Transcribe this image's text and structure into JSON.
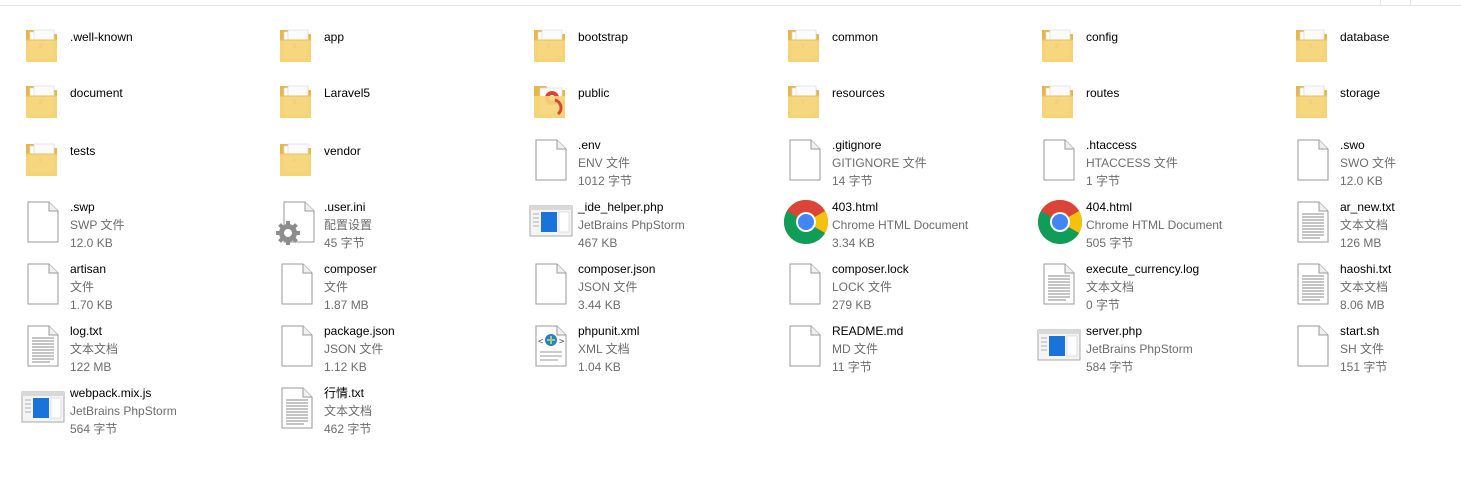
{
  "window": {
    "title": ""
  },
  "items": [
    {
      "name": ".well-known",
      "type": "",
      "size": "",
      "icon": "folder-icon"
    },
    {
      "name": "app",
      "type": "",
      "size": "",
      "icon": "folder-icon"
    },
    {
      "name": "bootstrap",
      "type": "",
      "size": "",
      "icon": "folder-icon"
    },
    {
      "name": "common",
      "type": "",
      "size": "",
      "icon": "folder-icon"
    },
    {
      "name": "config",
      "type": "",
      "size": "",
      "icon": "folder-icon"
    },
    {
      "name": "database",
      "type": "",
      "size": "",
      "icon": "folder-icon"
    },
    {
      "name": "document",
      "type": "",
      "size": "",
      "icon": "folder-icon"
    },
    {
      "name": "Laravel5",
      "type": "",
      "size": "",
      "icon": "folder-icon"
    },
    {
      "name": "public",
      "type": "",
      "size": "",
      "icon": "folder-chrome-icon"
    },
    {
      "name": "resources",
      "type": "",
      "size": "",
      "icon": "folder-icon"
    },
    {
      "name": "routes",
      "type": "",
      "size": "",
      "icon": "folder-icon"
    },
    {
      "name": "storage",
      "type": "",
      "size": "",
      "icon": "folder-icon"
    },
    {
      "name": "tests",
      "type": "",
      "size": "",
      "icon": "folder-icon"
    },
    {
      "name": "vendor",
      "type": "",
      "size": "",
      "icon": "folder-icon"
    },
    {
      "name": ".env",
      "type": "ENV 文件",
      "size": "1012 字节",
      "icon": "file-icon"
    },
    {
      "name": ".gitignore",
      "type": "GITIGNORE 文件",
      "size": "14 字节",
      "icon": "file-icon"
    },
    {
      "name": ".htaccess",
      "type": "HTACCESS 文件",
      "size": "1 字节",
      "icon": "file-icon"
    },
    {
      "name": ".swo",
      "type": "SWO 文件",
      "size": "12.0 KB",
      "icon": "file-icon"
    },
    {
      "name": ".swp",
      "type": "SWP 文件",
      "size": "12.0 KB",
      "icon": "file-icon"
    },
    {
      "name": ".user.ini",
      "type": "配置设置",
      "size": "45 字节",
      "icon": "settings-file-icon"
    },
    {
      "name": "_ide_helper.php",
      "type": "JetBrains PhpStorm",
      "size": "467 KB",
      "icon": "phpstorm-file-icon"
    },
    {
      "name": "403.html",
      "type": "Chrome HTML Document",
      "size": "3.34 KB",
      "icon": "chrome-icon"
    },
    {
      "name": "404.html",
      "type": "Chrome HTML Document",
      "size": "505 字节",
      "icon": "chrome-icon"
    },
    {
      "name": "ar_new.txt",
      "type": "文本文档",
      "size": "126 MB",
      "icon": "text-file-icon"
    },
    {
      "name": "artisan",
      "type": "文件",
      "size": "1.70 KB",
      "icon": "file-icon"
    },
    {
      "name": "composer",
      "type": "文件",
      "size": "1.87 MB",
      "icon": "file-icon"
    },
    {
      "name": "composer.json",
      "type": "JSON 文件",
      "size": "3.44 KB",
      "icon": "file-icon"
    },
    {
      "name": "composer.lock",
      "type": "LOCK 文件",
      "size": "279 KB",
      "icon": "file-icon"
    },
    {
      "name": "execute_currency.log",
      "type": "文本文档",
      "size": "0 字节",
      "icon": "text-file-icon"
    },
    {
      "name": "haoshi.txt",
      "type": "文本文档",
      "size": "8.06 MB",
      "icon": "text-file-icon"
    },
    {
      "name": "log.txt",
      "type": "文本文档",
      "size": "122 MB",
      "icon": "text-file-icon"
    },
    {
      "name": "package.json",
      "type": "JSON 文件",
      "size": "1.12 KB",
      "icon": "file-icon"
    },
    {
      "name": "phpunit.xml",
      "type": "XML 文档",
      "size": "1.04 KB",
      "icon": "xml-file-icon"
    },
    {
      "name": "README.md",
      "type": "MD 文件",
      "size": "11 字节",
      "icon": "file-icon"
    },
    {
      "name": "server.php",
      "type": "JetBrains PhpStorm",
      "size": "584 字节",
      "icon": "phpstorm-file-icon"
    },
    {
      "name": "start.sh",
      "type": "SH 文件",
      "size": "151 字节",
      "icon": "file-icon"
    },
    {
      "name": "webpack.mix.js",
      "type": "JetBrains PhpStorm",
      "size": "564 字节",
      "icon": "phpstorm-file-icon"
    },
    {
      "name": "行情.txt",
      "type": "文本文档",
      "size": "462 字节",
      "icon": "text-file-icon"
    }
  ]
}
